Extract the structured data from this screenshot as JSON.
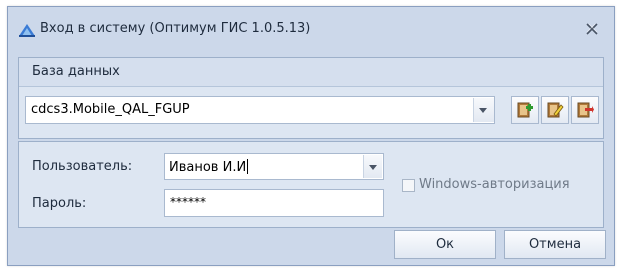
{
  "window": {
    "title": "Вход в систему (Оптимум ГИС 1.0.5.13)",
    "close_icon": "close-icon"
  },
  "database": {
    "label": "База данных",
    "selected": "cdcs3.Mobile_QAL_FGUP",
    "toolbar_icons": [
      "add-database-icon",
      "edit-database-icon",
      "delete-database-icon"
    ]
  },
  "login": {
    "user_label": "Пользователь:",
    "user_value": "Иванов И.И",
    "password_label": "Пароль:",
    "password_value": "******",
    "windows_auth_label": "Windows-авторизация",
    "windows_auth_checked": false
  },
  "buttons": {
    "ok": "Ок",
    "cancel": "Отмена"
  },
  "colors": {
    "window_background": "#ccd8ea",
    "panel_background": "#dde6f2",
    "accent_green": "#2e9a2e",
    "accent_red": "#d0342c"
  }
}
